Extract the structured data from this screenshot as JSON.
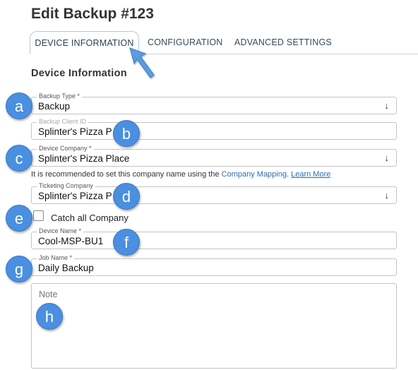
{
  "page": {
    "title": "Edit Backup #123"
  },
  "tabs": [
    {
      "label": "DEVICE INFORMATION",
      "active": true
    },
    {
      "label": "CONFIGURATION",
      "active": false
    },
    {
      "label": "ADVANCED SETTINGS",
      "active": false
    }
  ],
  "section": {
    "title": "Device Information"
  },
  "fields": {
    "backup_type": {
      "label": "Backup Type *",
      "value": "Backup"
    },
    "backup_client_id": {
      "label": "Backup Client ID",
      "value": "Splinter's Pizza P"
    },
    "device_company": {
      "label": "Device Company *",
      "value": "Splinter's Pizza Place"
    },
    "ticketing_company": {
      "label": "Ticketing Company",
      "value": "Splinter's Pizza P"
    },
    "device_name": {
      "label": "Device Name *",
      "value": "Cool-MSP-BU1"
    },
    "job_name": {
      "label": "Job Name *",
      "value": "Daily Backup"
    },
    "note": {
      "placeholder": "Note"
    }
  },
  "hint": {
    "text": "It is recommended to set this company name using the ",
    "link1": "Company Mapping",
    "sep": ". ",
    "link2": "Learn More"
  },
  "catch_all": {
    "label": "Catch all Company",
    "checked": false
  },
  "caret_glyph": "↓",
  "badges": [
    "a",
    "b",
    "c",
    "d",
    "e",
    "f",
    "g",
    "h"
  ],
  "colors": {
    "badge": "#4a8fe0",
    "link": "#2f6db0",
    "arrow": "#5b9be0"
  }
}
